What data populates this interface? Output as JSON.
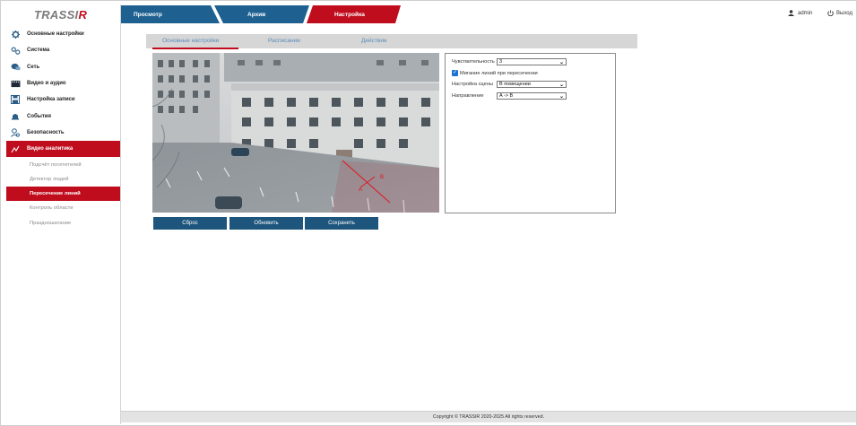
{
  "brand": {
    "logo_main": "TRASSI",
    "logo_accent": "R"
  },
  "sidebar": {
    "items": [
      {
        "label": "Основные настройки",
        "icon": "gear-icon"
      },
      {
        "label": "Система",
        "icon": "cogs-icon"
      },
      {
        "label": "Сеть",
        "icon": "network-icon"
      },
      {
        "label": "Видео и аудио",
        "icon": "film-icon"
      },
      {
        "label": "Настройка записи",
        "icon": "floppy-disk-icon"
      },
      {
        "label": "События",
        "icon": "alarm-bell-icon"
      },
      {
        "label": "Безопасность",
        "icon": "user-shield-icon"
      },
      {
        "label": "Видео аналитика",
        "icon": "analytics-icon"
      }
    ],
    "subitems": [
      {
        "label": "Подсчёт посетителей"
      },
      {
        "label": "Детектор людей"
      },
      {
        "label": "Пересечение линий"
      },
      {
        "label": "Контроль области"
      },
      {
        "label": "Праздношатание"
      }
    ]
  },
  "top_tabs": [
    {
      "label": "Просмотр"
    },
    {
      "label": "Архив"
    },
    {
      "label": "Настройка"
    }
  ],
  "user": {
    "name": "admin",
    "logout": "Выход"
  },
  "sub_tabs": [
    {
      "label": "Основные настройки"
    },
    {
      "label": "Расписание"
    },
    {
      "label": "Действие"
    }
  ],
  "camera": {
    "point_a": "A",
    "point_b": "B"
  },
  "buttons": {
    "reset": "Сброс",
    "refresh": "Обновить",
    "save": "Сохранить"
  },
  "settings": {
    "sensitivity_label": "Чувствительность",
    "sensitivity_value": "3",
    "blink_label": "Мигание линий при пересечении",
    "blink_checked": true,
    "scene_label": "Настройка сцены",
    "scene_value": "В помещении",
    "direction_label": "Направление",
    "direction_value": "A -> B"
  },
  "footer": {
    "copyright": "Copyright © TRASSIR 2020-2025 All rights reserved."
  },
  "colors": {
    "brand_red": "#c00d1e",
    "nav_blue": "#1e6190",
    "button_blue": "#1d557c",
    "subtab_text": "#5a8cb8"
  }
}
